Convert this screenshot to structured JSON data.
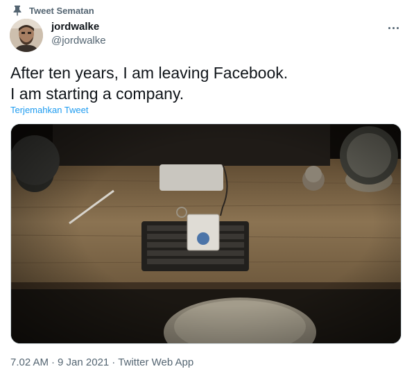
{
  "pinned": {
    "label": "Tweet Sematan",
    "icon": "pin-icon"
  },
  "user": {
    "display_name": "jordwalke",
    "handle": "@jordwalke",
    "avatar_icon": "avatar"
  },
  "menu": {
    "icon": "more-icon"
  },
  "tweet": {
    "text": "After ten years, I am leaving Facebook.\nI am starting a company.",
    "translate_label": "Terjemahkan Tweet"
  },
  "media": {
    "type": "photo",
    "alt": ""
  },
  "meta": {
    "time": "7.02 AM",
    "date": "9 Jan 2021",
    "source": "Twitter Web App",
    "separator": "·"
  },
  "colors": {
    "text_primary": "#0f1419",
    "text_secondary": "#536471",
    "link": "#1d9bf0",
    "border": "#cfd9de"
  }
}
